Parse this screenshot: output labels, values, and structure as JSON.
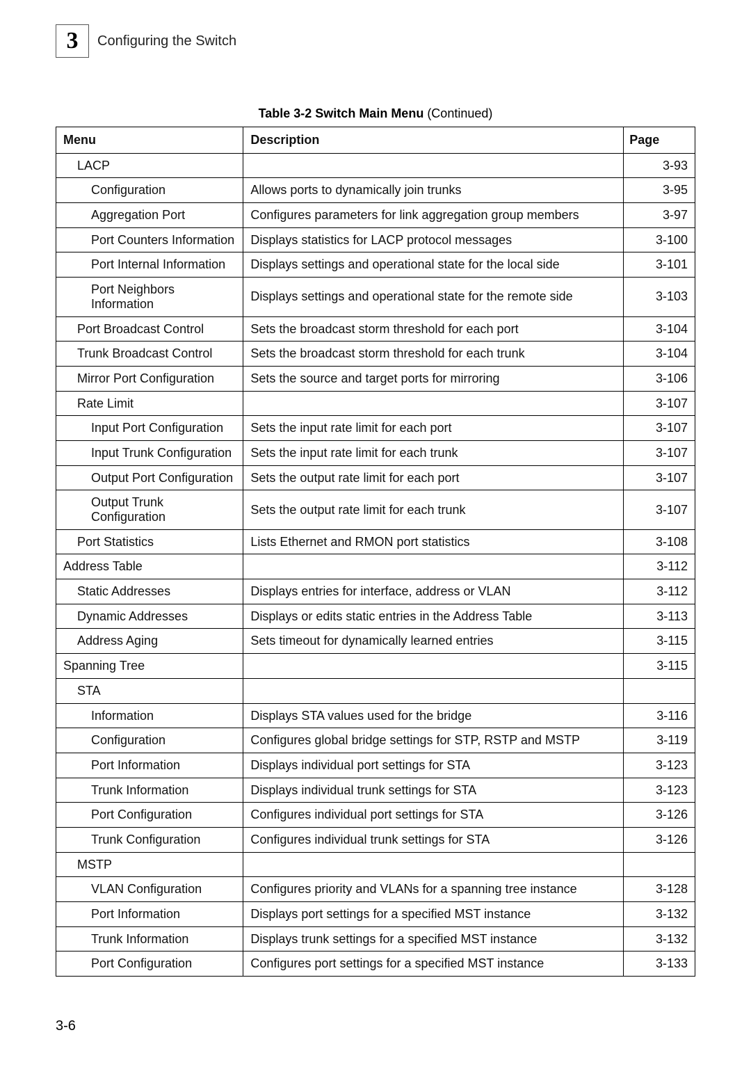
{
  "chapter_number": "3",
  "chapter_title": "Configuring the Switch",
  "table": {
    "caption_strong": "Table 3-2   Switch Main Menu",
    "caption_tail": " (Continued)",
    "headers": {
      "menu": "Menu",
      "description": "Description",
      "page": "Page"
    },
    "rows": [
      {
        "indent": 1,
        "menu": "LACP",
        "desc": "",
        "page": "3-93"
      },
      {
        "indent": 2,
        "menu": "Configuration",
        "desc": "Allows ports to dynamically join trunks",
        "page": "3-95"
      },
      {
        "indent": 2,
        "menu": "Aggregation Port",
        "desc": "Configures parameters for link aggregation group members",
        "page": "3-97"
      },
      {
        "indent": 2,
        "menu": "Port Counters Information",
        "desc": "Displays statistics for LACP protocol messages",
        "page": "3-100"
      },
      {
        "indent": 2,
        "menu": "Port Internal Information",
        "desc": "Displays settings and operational state for the local side",
        "page": "3-101"
      },
      {
        "indent": 2,
        "menu": "Port Neighbors Information",
        "desc": "Displays settings and operational state for the remote side",
        "page": "3-103"
      },
      {
        "indent": 1,
        "menu": "Port Broadcast Control",
        "desc": "Sets the broadcast storm threshold for each port",
        "page": "3-104"
      },
      {
        "indent": 1,
        "menu": "Trunk Broadcast Control",
        "desc": "Sets the broadcast storm threshold for each trunk",
        "page": "3-104"
      },
      {
        "indent": 1,
        "menu": "Mirror Port Configuration",
        "desc": "Sets the source and target ports for mirroring",
        "page": "3-106"
      },
      {
        "indent": 1,
        "menu": "Rate Limit",
        "desc": "",
        "page": "3-107"
      },
      {
        "indent": 2,
        "menu": "Input Port Configuration",
        "desc": "Sets the input rate limit for each port",
        "page": "3-107"
      },
      {
        "indent": 2,
        "menu": "Input Trunk Configuration",
        "desc": "Sets the input rate limit for each trunk",
        "page": "3-107"
      },
      {
        "indent": 2,
        "menu": "Output Port Configuration",
        "desc": "Sets the output rate limit for each port",
        "page": "3-107"
      },
      {
        "indent": 2,
        "menu": "Output Trunk Configuration",
        "desc": "Sets the output rate limit for each trunk",
        "page": "3-107"
      },
      {
        "indent": 1,
        "menu": "Port Statistics",
        "desc": "Lists Ethernet and RMON port statistics",
        "page": "3-108"
      },
      {
        "indent": 0,
        "menu": "Address Table",
        "desc": "",
        "page": "3-112"
      },
      {
        "indent": 1,
        "menu": "Static Addresses",
        "desc": "Displays entries for interface, address or VLAN",
        "page": "3-112"
      },
      {
        "indent": 1,
        "menu": "Dynamic Addresses",
        "desc": "Displays or edits static entries in the Address Table",
        "page": "3-113"
      },
      {
        "indent": 1,
        "menu": "Address Aging",
        "desc": "Sets timeout for dynamically learned entries",
        "page": "3-115"
      },
      {
        "indent": 0,
        "menu": "Spanning Tree",
        "desc": "",
        "page": "3-115"
      },
      {
        "indent": 1,
        "menu": "STA",
        "desc": "",
        "page": ""
      },
      {
        "indent": 2,
        "menu": "Information",
        "desc": "Displays STA values used for the bridge",
        "page": "3-116"
      },
      {
        "indent": 2,
        "menu": "Configuration",
        "desc": "Configures global bridge settings for STP, RSTP and MSTP",
        "page": "3-119"
      },
      {
        "indent": 2,
        "menu": "Port Information",
        "desc": "Displays individual port settings for STA",
        "page": "3-123"
      },
      {
        "indent": 2,
        "menu": "Trunk Information",
        "desc": "Displays individual trunk settings for STA",
        "page": "3-123"
      },
      {
        "indent": 2,
        "menu": "Port Configuration",
        "desc": "Configures individual port settings for STA",
        "page": "3-126"
      },
      {
        "indent": 2,
        "menu": "Trunk Configuration",
        "desc": "Configures individual trunk settings for STA",
        "page": "3-126"
      },
      {
        "indent": 1,
        "menu": "MSTP",
        "desc": "",
        "page": ""
      },
      {
        "indent": 2,
        "menu": "VLAN Configuration",
        "desc": "Configures priority and VLANs for a spanning tree instance",
        "page": "3-128"
      },
      {
        "indent": 2,
        "menu": "Port Information",
        "desc": "Displays port settings for a specified MST instance",
        "page": "3-132"
      },
      {
        "indent": 2,
        "menu": "Trunk Information",
        "desc": "Displays trunk settings for a specified MST instance",
        "page": "3-132"
      },
      {
        "indent": 2,
        "menu": "Port Configuration",
        "desc": "Configures port settings for a specified MST instance",
        "page": "3-133"
      }
    ]
  },
  "footer_page": "3-6"
}
